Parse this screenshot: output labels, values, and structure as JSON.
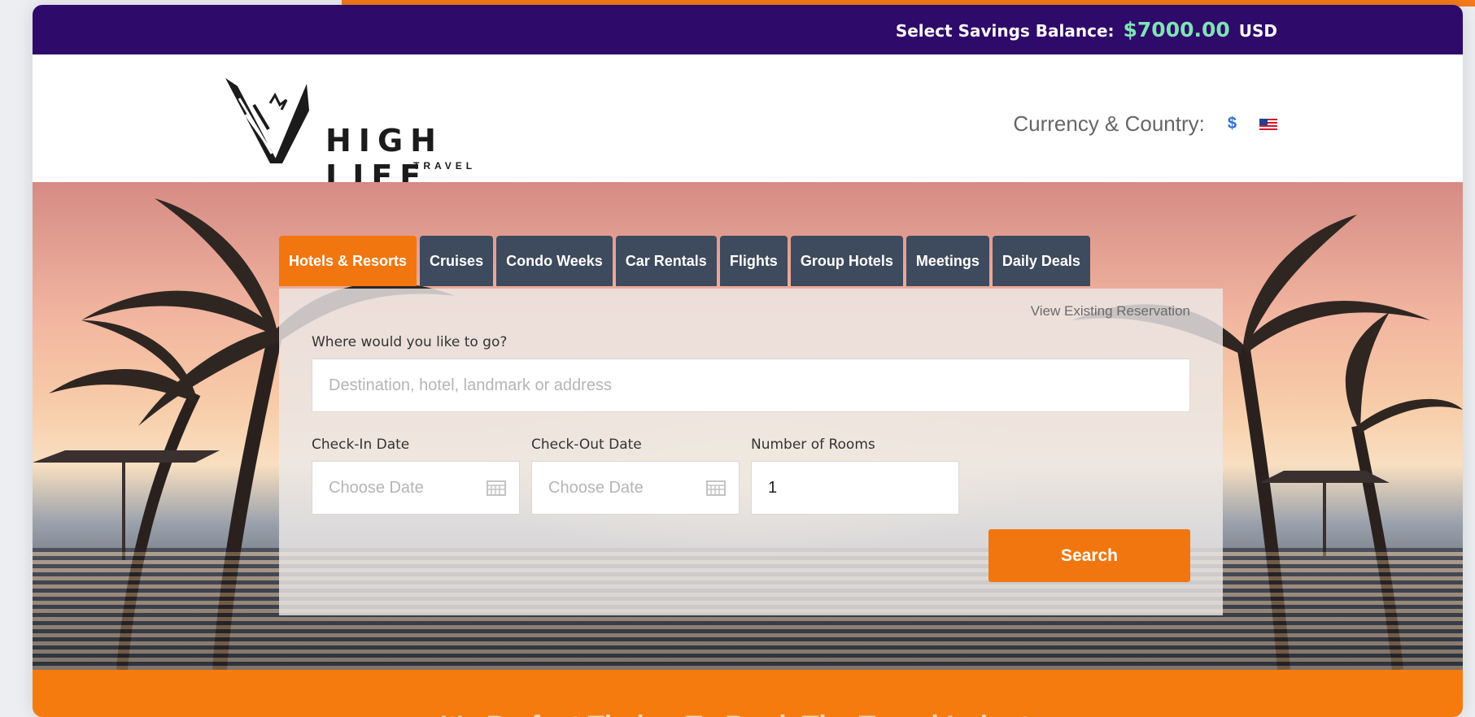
{
  "balance": {
    "label": "Select Savings Balance:",
    "amount": "$7000.00",
    "currency": "USD"
  },
  "brand": {
    "name": "HIGH LIFE",
    "sub": "TRAVEL",
    "logo_icon": "eagle-v-icon"
  },
  "currency": {
    "label": "Currency & Country:",
    "symbol": "$",
    "flag_icon": "us-flag-icon"
  },
  "tabs": [
    {
      "label": "Hotels & Resorts",
      "active": true
    },
    {
      "label": "Cruises"
    },
    {
      "label": "Condo Weeks"
    },
    {
      "label": "Car Rentals"
    },
    {
      "label": "Flights"
    },
    {
      "label": "Group Hotels"
    },
    {
      "label": "Meetings"
    },
    {
      "label": "Daily Deals"
    }
  ],
  "search": {
    "view_existing": "View Existing Reservation",
    "destination_label": "Where would you like to go?",
    "destination_placeholder": "Destination, hotel, landmark or address",
    "checkin_label": "Check-In Date",
    "checkin_placeholder": "Choose Date",
    "checkout_label": "Check-Out Date",
    "checkout_placeholder": "Choose Date",
    "rooms_label": "Number of Rooms",
    "rooms_value": "1",
    "button": "Search"
  },
  "footer": {
    "tagline": "It's Perfect Timing To Book The Travel Industry"
  },
  "colors": {
    "accent": "#f2760f",
    "topbar": "#2e0a6b",
    "tab": "#3e4a5d",
    "balance_amount": "#7fe3b5"
  }
}
